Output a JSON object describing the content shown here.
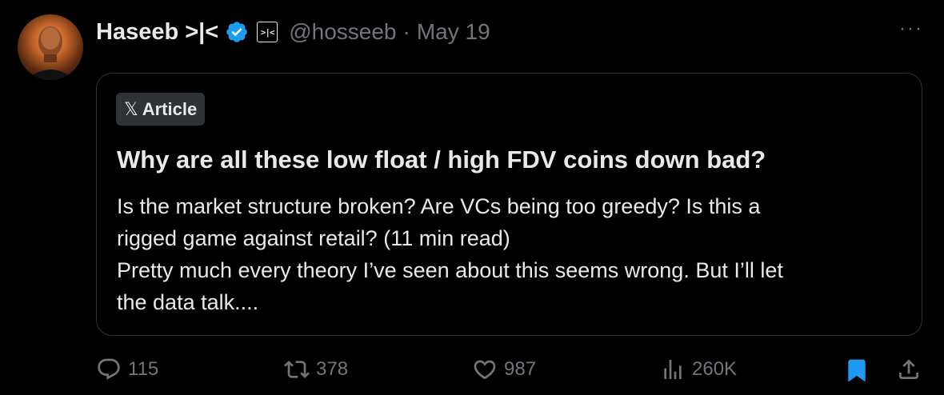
{
  "author": {
    "name": "Haseeb >|<",
    "affiliate_label": ">|<",
    "handle": "@hosseeb",
    "separator": "·",
    "date": "May 19"
  },
  "more_label": "···",
  "article": {
    "badge_label": "Article",
    "badge_logo": "𝕏",
    "title": "Why are all these low float / high FDV coins down bad?",
    "description_lines": [
      "Is the market structure broken? Are VCs being too greedy? Is this a",
      "rigged game against retail? (11 min read)",
      "Pretty much every theory I’ve seen about this seems wrong. But I’ll let",
      "the data talk...."
    ]
  },
  "actions": {
    "replies": "115",
    "reposts": "378",
    "likes": "987",
    "views": "260K"
  },
  "colors": {
    "background": "#000000",
    "text": "#e7e9ea",
    "muted": "#71767b",
    "verified": "#1d9bf0",
    "bookmark": "#1d9bf0",
    "border": "#2f3336"
  },
  "icons": [
    "avatar",
    "verified-badge-icon",
    "affiliate-badge-icon",
    "more-icon",
    "x-logo-icon",
    "reply-icon",
    "repost-icon",
    "like-icon",
    "views-icon",
    "bookmark-icon",
    "share-icon"
  ]
}
